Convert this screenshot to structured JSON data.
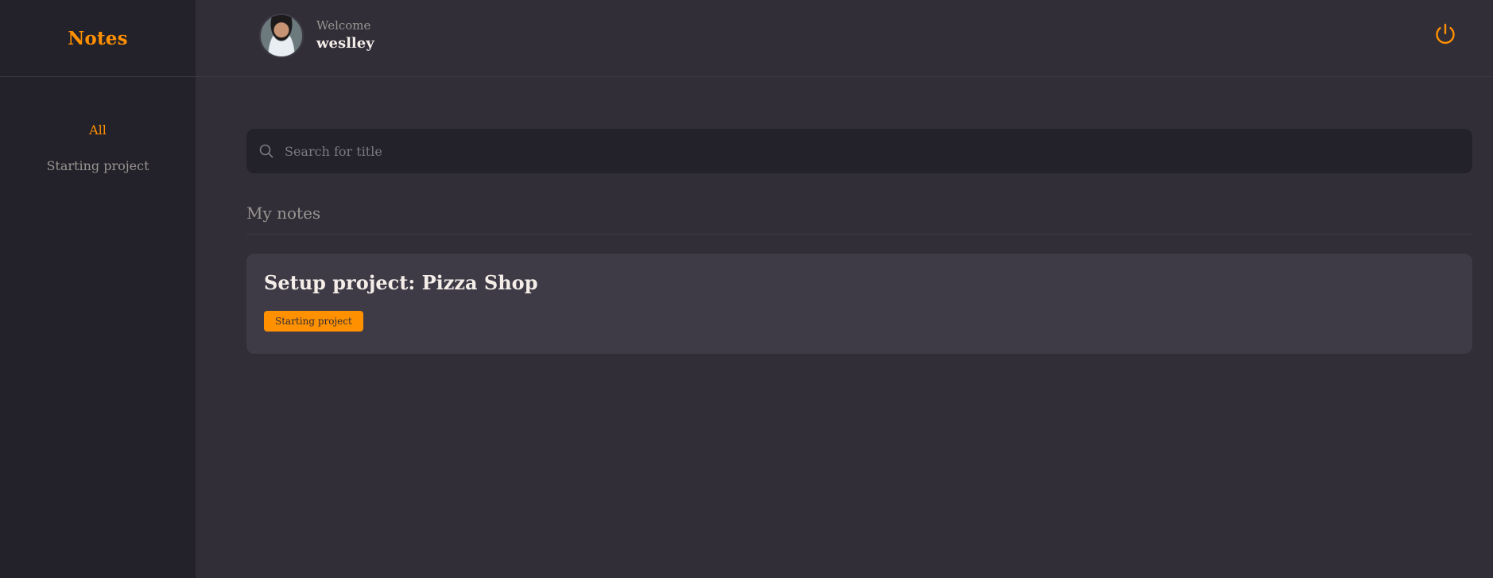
{
  "brand": {
    "title": "Notes"
  },
  "profile": {
    "welcome_label": "Welcome",
    "username": "weslley"
  },
  "sidebar": {
    "items": [
      {
        "label": "All",
        "active": true
      },
      {
        "label": "Starting project",
        "active": false
      }
    ]
  },
  "search": {
    "placeholder": "Search for title",
    "value": ""
  },
  "notes_section": {
    "title": "My notes",
    "notes": [
      {
        "title": "Setup project: Pizza Shop",
        "tags": [
          "Starting project"
        ]
      }
    ]
  },
  "colors": {
    "accent": "#FF9000",
    "background": "#312E38",
    "sidebar": "#232129",
    "card": "#3E3B47",
    "text": "#F4EDE8",
    "muted": "#999591"
  },
  "icons": {
    "search": "search-icon",
    "logout": "power-icon"
  }
}
